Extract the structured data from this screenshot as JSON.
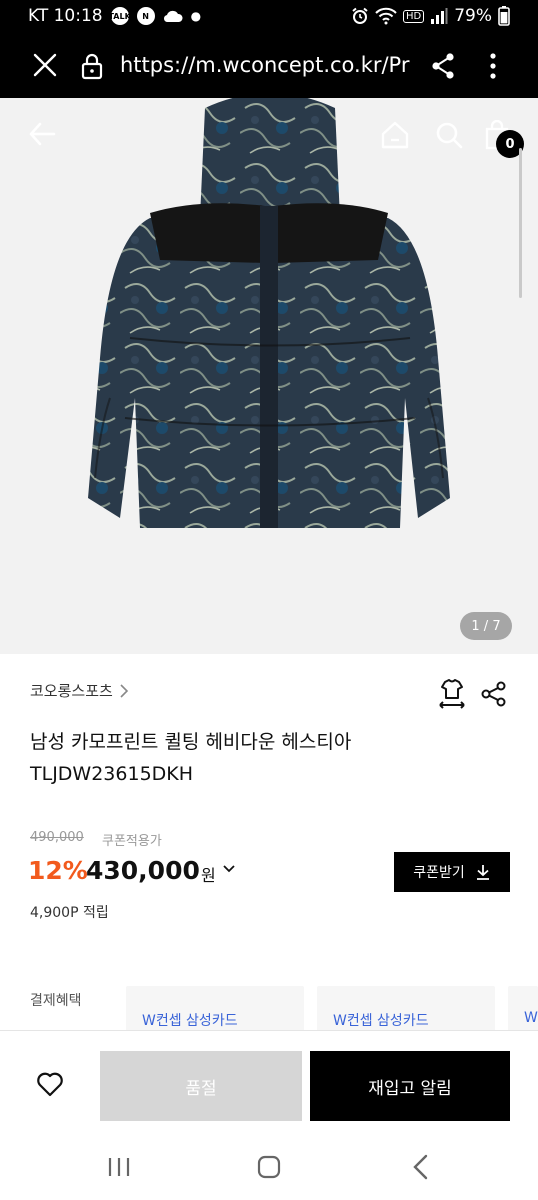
{
  "status_bar": {
    "carrier_time": "KT 10:18",
    "notif_1": "TALK",
    "notif_2": "N",
    "battery": "79%",
    "hd": "HD"
  },
  "browser": {
    "url": "https://m.wconcept.co.kr/Prc"
  },
  "hero": {
    "cart_count": "0",
    "image_counter": "1 / 7"
  },
  "product": {
    "brand": "코오롱스포츠",
    "title_line1": "남성 카모프린트 퀼팅 헤비다운 헤스티아",
    "title_line2": "TLJDW23615DKH",
    "original_price": "490,000",
    "coupon_note": "쿠폰적용가",
    "discount": "12%",
    "price": "430,000",
    "currency": "원",
    "coupon_button": "쿠폰받기",
    "points": "4,900P 적립"
  },
  "payment": {
    "label": "결제혜택",
    "cards": [
      "W컨셉 삼성카드",
      "W컨셉 삼성카드",
      "W"
    ]
  },
  "actions": {
    "soldout": "품절",
    "restock": "재입고 알림"
  },
  "colors": {
    "discount": "#f25a1d",
    "card_text": "#3a64d8",
    "black": "#000000"
  }
}
